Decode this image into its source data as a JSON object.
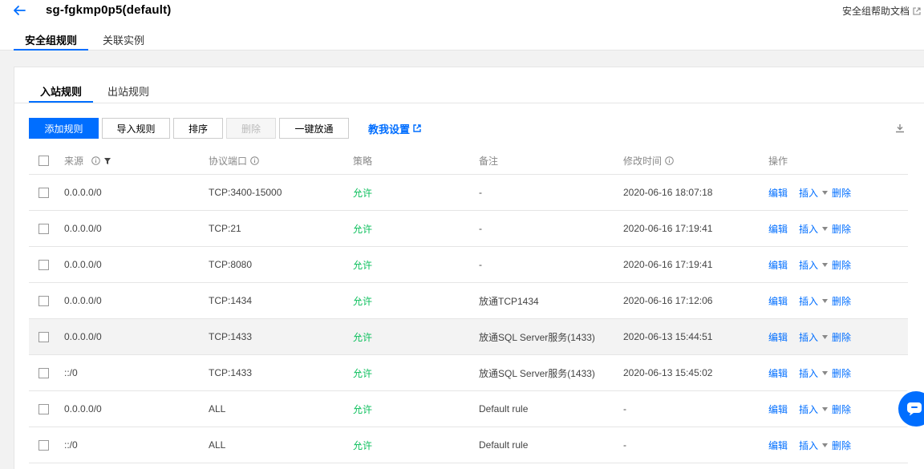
{
  "header": {
    "title": "sg-fgkmp0p5(default)",
    "help_link": "安全组帮助文档",
    "tabs": [
      {
        "label": "安全组规则",
        "active": true
      },
      {
        "label": "关联实例",
        "active": false
      }
    ]
  },
  "rules": {
    "tabs": [
      {
        "label": "入站规则",
        "active": true
      },
      {
        "label": "出站规则",
        "active": false
      }
    ],
    "toolbar": {
      "add": "添加规则",
      "import": "导入规则",
      "sort": "排序",
      "delete": "删除",
      "open_all": "一键放通",
      "guide": "教我设置"
    },
    "columns": {
      "source": "来源",
      "port": "协议端口",
      "policy": "策略",
      "note": "备注",
      "modified": "修改时间",
      "ops": "操作"
    },
    "row_ops": {
      "edit": "编辑",
      "insert": "插入",
      "delete": "删除"
    },
    "rows": [
      {
        "source": "0.0.0.0/0",
        "port": "TCP:3400-15000",
        "policy": "允许",
        "note": "-",
        "modified": "2020-06-16 18:07:18"
      },
      {
        "source": "0.0.0.0/0",
        "port": "TCP:21",
        "policy": "允许",
        "note": "-",
        "modified": "2020-06-16 17:19:41"
      },
      {
        "source": "0.0.0.0/0",
        "port": "TCP:8080",
        "policy": "允许",
        "note": "-",
        "modified": "2020-06-16 17:19:41"
      },
      {
        "source": "0.0.0.0/0",
        "port": "TCP:1434",
        "policy": "允许",
        "note": "放通TCP1434",
        "modified": "2020-06-16 17:12:06"
      },
      {
        "source": "0.0.0.0/0",
        "port": "TCP:1433",
        "policy": "允许",
        "note": "放通SQL Server服务(1433)",
        "modified": "2020-06-13 15:44:51"
      },
      {
        "source": "::/0",
        "port": "TCP:1433",
        "policy": "允许",
        "note": "放通SQL Server服务(1433)",
        "modified": "2020-06-13 15:45:02"
      },
      {
        "source": "0.0.0.0/0",
        "port": "ALL",
        "policy": "允许",
        "note": "Default rule",
        "modified": "-"
      },
      {
        "source": "::/0",
        "port": "ALL",
        "policy": "允许",
        "note": "Default rule",
        "modified": "-"
      }
    ]
  },
  "colors": {
    "accent": "#006eff",
    "allow": "#0abf5b"
  },
  "icons": [
    "back-arrow-icon",
    "external-link-icon",
    "info-icon",
    "filter-icon",
    "download-icon",
    "caret-down-icon",
    "chat-icon"
  ]
}
